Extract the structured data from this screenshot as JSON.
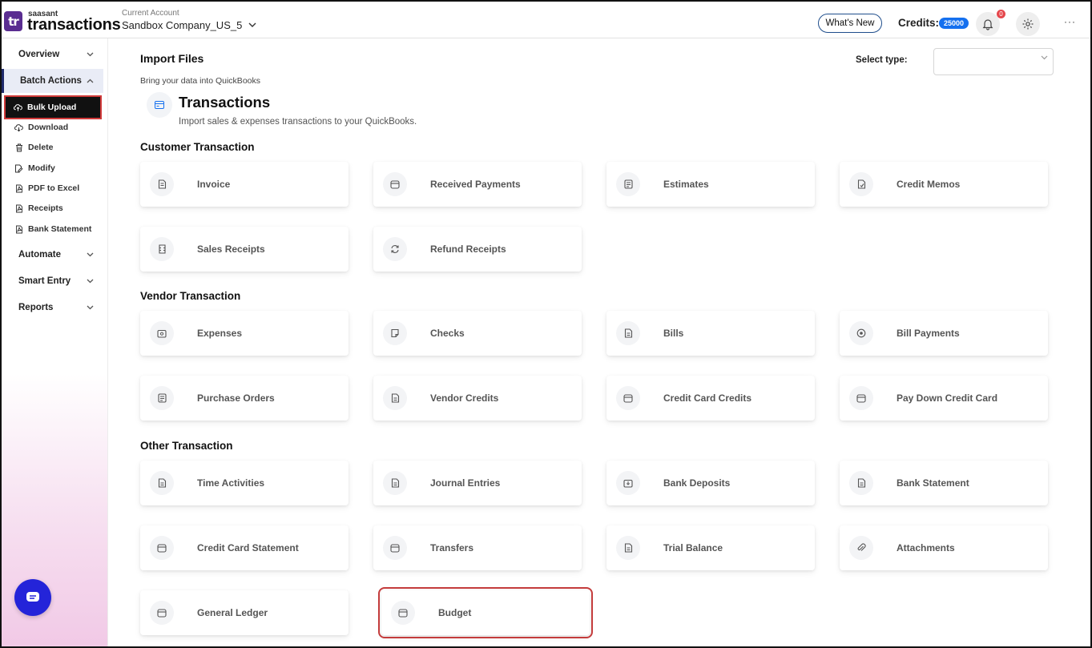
{
  "header": {
    "logo_small": "saasant",
    "logo_big": "transactions",
    "logo_mark": "tr",
    "current_account_label": "Current Account",
    "current_account_value": "Sandbox Company_US_5",
    "whats_new": "What's New",
    "credits_label": "Credits:",
    "credits_value": "25000",
    "notification_count": "0",
    "more": "···"
  },
  "sidebar": {
    "overview": "Overview",
    "batch_actions": "Batch Actions",
    "items": [
      {
        "label": "Bulk Upload",
        "icon": "cloud-upload-icon"
      },
      {
        "label": "Download",
        "icon": "download-icon"
      },
      {
        "label": "Delete",
        "icon": "trash-icon"
      },
      {
        "label": "Modify",
        "icon": "edit-file-icon"
      },
      {
        "label": "PDF to Excel",
        "icon": "pdf-icon"
      },
      {
        "label": "Receipts",
        "icon": "receipt-icon"
      },
      {
        "label": "Bank Statement",
        "icon": "bank-statement-icon"
      }
    ],
    "automate": "Automate",
    "smart_entry": "Smart Entry",
    "reports": "Reports"
  },
  "main": {
    "import_title": "Import Files",
    "import_sub": "Bring your data into QuickBooks",
    "select_type_label": "Select type:",
    "tx_title": "Transactions",
    "tx_desc": "Import sales & expenses transactions to your QuickBooks.",
    "sections": {
      "customer": "Customer Transaction",
      "vendor": "Vendor Transaction",
      "other": "Other Transaction"
    },
    "customer_cards": [
      "Invoice",
      "Received Payments",
      "Estimates",
      "Credit Memos",
      "Sales Receipts",
      "Refund Receipts"
    ],
    "vendor_cards": [
      "Expenses",
      "Checks",
      "Bills",
      "Bill Payments",
      "Purchase Orders",
      "Vendor Credits",
      "Credit Card Credits",
      "Pay Down Credit Card"
    ],
    "other_cards": [
      "Time Activities",
      "Journal Entries",
      "Bank Deposits",
      "Bank Statement",
      "Credit Card Statement",
      "Transfers",
      "Trial Balance",
      "Attachments",
      "General Ledger",
      "Budget"
    ]
  },
  "colors": {
    "accent": "#1570ef",
    "brand": "#5a2d91",
    "highlight": "#c43c3c",
    "chat": "#2424d9"
  }
}
